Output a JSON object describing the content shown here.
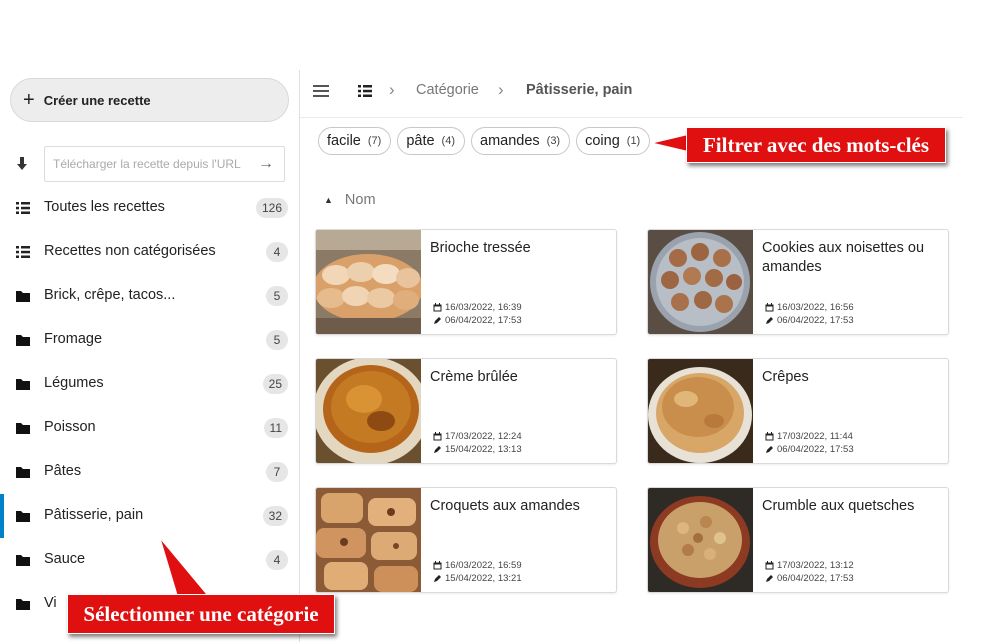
{
  "sidebar": {
    "create_label": "Créer une recette",
    "import_placeholder": "Télécharger la recette depuis l'URL",
    "items": [
      {
        "label": "Toutes les recettes",
        "count": "126",
        "icon": "list-icon"
      },
      {
        "label": "Recettes non catégorisées",
        "count": "4",
        "icon": "list-icon"
      },
      {
        "label": "Brick, crêpe, tacos...",
        "count": "5",
        "icon": "folder-icon"
      },
      {
        "label": "Fromage",
        "count": "5",
        "icon": "folder-icon"
      },
      {
        "label": "Légumes",
        "count": "25",
        "icon": "folder-icon"
      },
      {
        "label": "Poisson",
        "count": "11",
        "icon": "folder-icon"
      },
      {
        "label": "Pâtes",
        "count": "7",
        "icon": "folder-icon"
      },
      {
        "label": "Pâtisserie, pain",
        "count": "32",
        "icon": "folder-icon",
        "active": true
      },
      {
        "label": "Sauce",
        "count": "4",
        "icon": "folder-icon"
      },
      {
        "label": "Vi",
        "count": "",
        "icon": "folder-icon"
      }
    ]
  },
  "header": {
    "crumbs": [
      "Catégorie",
      "Pâtisserie, pain"
    ]
  },
  "tags": [
    {
      "label": "facile",
      "count": "(7)"
    },
    {
      "label": "pâte",
      "count": "(4)"
    },
    {
      "label": "amandes",
      "count": "(3)"
    },
    {
      "label": "coing",
      "count": "(1)"
    }
  ],
  "sort": {
    "label": "Nom"
  },
  "recipes": [
    {
      "title": "Brioche tressée",
      "created": "16/03/2022, 16:39",
      "modified": "06/04/2022, 17:53"
    },
    {
      "title": "Cookies aux noisettes ou amandes",
      "created": "16/03/2022, 16:56",
      "modified": "06/04/2022, 17:53"
    },
    {
      "title": "Crème brûlée",
      "created": "17/03/2022, 12:24",
      "modified": "15/04/2022, 13:13"
    },
    {
      "title": "Crêpes",
      "created": "17/03/2022, 11:44",
      "modified": "06/04/2022, 17:53"
    },
    {
      "title": "Croquets aux amandes",
      "created": "16/03/2022, 16:59",
      "modified": "15/04/2022, 13:21"
    },
    {
      "title": "Crumble aux quetsches",
      "created": "17/03/2022, 13:12",
      "modified": "06/04/2022, 17:53"
    }
  ],
  "annotations": {
    "filter": "Filtrer avec des mots-clés",
    "category": "Sélectionner une catégorie"
  },
  "colors": {
    "accent": "#0082c9",
    "callout": "#e01010"
  }
}
